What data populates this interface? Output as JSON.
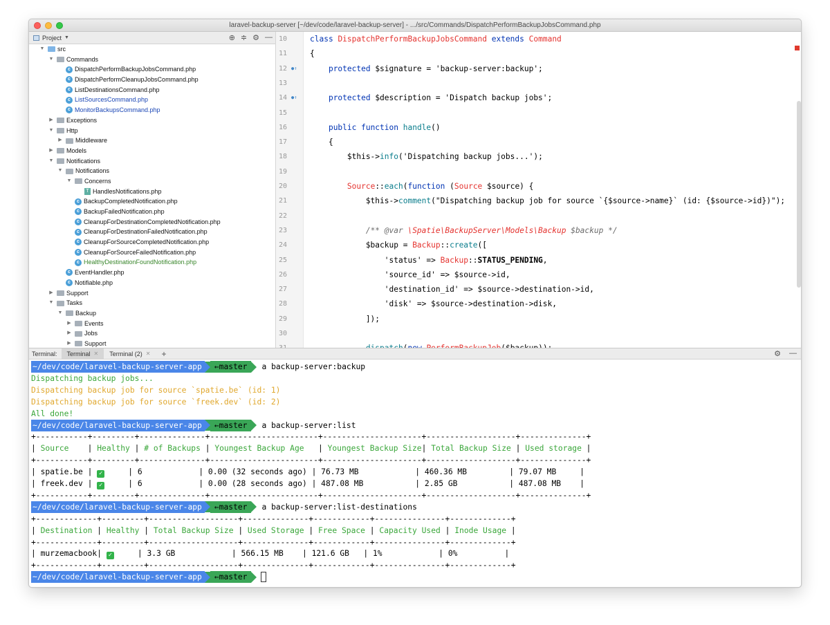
{
  "window": {
    "title": "laravel-backup-server [~/dev/code/laravel-backup-server] - .../src/Commands/DispatchPerformBackupJobsCommand.php"
  },
  "project_panel": {
    "title": "Project",
    "tree": [
      {
        "label": "src",
        "depth": 0,
        "type": "folder-blue",
        "expanded": true
      },
      {
        "label": "Commands",
        "depth": 1,
        "type": "folder",
        "expanded": true
      },
      {
        "label": "DispatchPerformBackupJobsCommand.php",
        "depth": 2,
        "type": "class"
      },
      {
        "label": "DispatchPerformCleanupJobsCommand.php",
        "depth": 2,
        "type": "class"
      },
      {
        "label": "ListDestinationsCommand.php",
        "depth": 2,
        "type": "class"
      },
      {
        "label": "ListSourcesCommand.php",
        "depth": 2,
        "type": "class",
        "color": "blue"
      },
      {
        "label": "MonitorBackupsCommand.php",
        "depth": 2,
        "type": "class",
        "color": "blue"
      },
      {
        "label": "Exceptions",
        "depth": 1,
        "type": "folder",
        "expanded": false
      },
      {
        "label": "Http",
        "depth": 1,
        "type": "folder",
        "expanded": true
      },
      {
        "label": "Middleware",
        "depth": 2,
        "type": "folder",
        "expanded": false
      },
      {
        "label": "Models",
        "depth": 1,
        "type": "folder",
        "expanded": false
      },
      {
        "label": "Notifications",
        "depth": 1,
        "type": "folder",
        "expanded": true
      },
      {
        "label": "Notifications",
        "depth": 2,
        "type": "folder",
        "expanded": true
      },
      {
        "label": "Concerns",
        "depth": 3,
        "type": "folder",
        "expanded": true
      },
      {
        "label": "HandlesNotifications.php",
        "depth": 4,
        "type": "trait"
      },
      {
        "label": "BackupCompletedNotification.php",
        "depth": 3,
        "type": "class"
      },
      {
        "label": "BackupFailedNotification.php",
        "depth": 3,
        "type": "class"
      },
      {
        "label": "CleanupForDestinationCompletedNotification.php",
        "depth": 3,
        "type": "class"
      },
      {
        "label": "CleanupForDestinationFailedNotification.php",
        "depth": 3,
        "type": "class"
      },
      {
        "label": "CleanupForSourceCompletedNotification.php",
        "depth": 3,
        "type": "class"
      },
      {
        "label": "CleanupForSourceFailedNotification.php",
        "depth": 3,
        "type": "class"
      },
      {
        "label": "HealthyDestinationFoundNotification.php",
        "depth": 3,
        "type": "class",
        "color": "green"
      },
      {
        "label": "EventHandler.php",
        "depth": 2,
        "type": "class"
      },
      {
        "label": "Notifiable.php",
        "depth": 2,
        "type": "class"
      },
      {
        "label": "Support",
        "depth": 1,
        "type": "folder",
        "expanded": false
      },
      {
        "label": "Tasks",
        "depth": 1,
        "type": "folder",
        "expanded": true
      },
      {
        "label": "Backup",
        "depth": 2,
        "type": "folder",
        "expanded": true
      },
      {
        "label": "Events",
        "depth": 3,
        "type": "folder",
        "expanded": false
      },
      {
        "label": "Jobs",
        "depth": 3,
        "type": "folder",
        "expanded": false
      },
      {
        "label": "Support",
        "depth": 3,
        "type": "folder",
        "expanded": false
      }
    ]
  },
  "editor": {
    "lines": [
      {
        "num": "10",
        "html": "<span class=\"kw\">class</span> <span class=\"cls\">DispatchPerformBackupJobsCommand</span> <span class=\"kw\">extends</span> <span class=\"cls\">Command</span>"
      },
      {
        "num": "11",
        "html": "{"
      },
      {
        "num": "12",
        "mark": "●↑",
        "html": "    <span class=\"kw\">protected</span> $signature = 'backup-server:backup';"
      },
      {
        "num": "13",
        "html": ""
      },
      {
        "num": "14",
        "mark": "●↑",
        "html": "    <span class=\"kw\">protected</span> $description = 'Dispatch backup jobs';"
      },
      {
        "num": "15",
        "html": ""
      },
      {
        "num": "16",
        "html": "    <span class=\"kw\">public function</span> <span class=\"fn\">handle</span>()"
      },
      {
        "num": "17",
        "html": "    {"
      },
      {
        "num": "18",
        "html": "        $this-><span class=\"fn\">info</span>('Dispatching backup jobs...');"
      },
      {
        "num": "19",
        "html": ""
      },
      {
        "num": "20",
        "html": "        <span class=\"cls\">Source</span>::<span class=\"fn\">each</span>(<span class=\"kw\">function</span> (<span class=\"cls\">Source</span> $source) {"
      },
      {
        "num": "21",
        "html": "            $this-><span class=\"fn\">comment</span>(\"Dispatching backup job for source `{$source->name}` (id: {$source->id})\");"
      },
      {
        "num": "22",
        "html": ""
      },
      {
        "num": "23",
        "html": "            <span class=\"cmt\">/** @var </span><span class=\"cmtcls\">\\Spatie\\BackupServer\\Models\\Backup</span><span class=\"cmt\"> $backup */</span>"
      },
      {
        "num": "24",
        "html": "            $backup = <span class=\"cls\">Backup</span>::<span class=\"fn\">create</span>(["
      },
      {
        "num": "25",
        "html": "                'status' => <span class=\"cls\">Backup</span>::<span class=\"bold\">STATUS_PENDING</span>,"
      },
      {
        "num": "26",
        "html": "                'source_id' => $source->id,"
      },
      {
        "num": "27",
        "html": "                'destination_id' => $source->destination->id,"
      },
      {
        "num": "28",
        "html": "                'disk' => $source->destination->disk,"
      },
      {
        "num": "29",
        "html": "            ]);"
      },
      {
        "num": "30",
        "html": ""
      },
      {
        "num": "31",
        "html": "            <span class=\"fn\">dispatch</span>(<span class=\"kw\">new</span> <span class=\"cls\">PerformBackupJob</span>($backup));"
      }
    ]
  },
  "terminal_tabs": {
    "label": "Terminal:",
    "tabs": [
      "Terminal",
      "Terminal (2)"
    ],
    "add": "+"
  },
  "terminal": {
    "prompt_path": "~/dev/code/laravel-backup-server-app",
    "prompt_branch": "←master",
    "commands": [
      "a backup-server:backup",
      "a backup-server:list",
      "a backup-server:list-destinations"
    ],
    "backup_output": [
      {
        "text": "Dispatching backup jobs...",
        "style": "green-out"
      },
      {
        "text": "Dispatching backup job for source `spatie.be` (id: 1)",
        "style": "yellow-out"
      },
      {
        "text": "Dispatching backup job for source `freek.dev` (id: 2)",
        "style": "yellow-out"
      },
      {
        "text": "All done!",
        "style": "green-out"
      }
    ],
    "list_table": {
      "border": "+-----------+---------+--------------+-----------------------+---------------------+-------------------+--------------+",
      "headers": [
        "Source",
        "Healthy",
        "# of Backups",
        "Youngest Backup Age",
        "Youngest Backup Size",
        "Total Backup Size",
        "Used storage"
      ],
      "widths": [
        10,
        8,
        13,
        22,
        20,
        18,
        13
      ],
      "rows": [
        [
          "spatie.be",
          "✅",
          "6",
          "0.00 (32 seconds ago)",
          "76.73 MB",
          "460.36 MB",
          "79.07 MB"
        ],
        [
          "freek.dev",
          "✅",
          "6",
          "0.00 (28 seconds ago)",
          "487.08 MB",
          "2.85 GB",
          "487.08 MB"
        ]
      ]
    },
    "dest_table": {
      "border": "+-------------+---------+-------------------+--------------+------------+---------------+-------------+",
      "headers": [
        "Destination",
        "Healthy",
        "Total Backup Size",
        "Used Storage",
        "Free Space",
        "Capacity Used",
        "Inode Usage"
      ],
      "widths": [
        12,
        8,
        18,
        13,
        11,
        14,
        12
      ],
      "rows": [
        [
          "murzemacbook",
          "✅",
          "3.3 GB",
          "566.15 MB",
          "121.6 GB",
          "1%",
          "0%"
        ]
      ]
    }
  }
}
